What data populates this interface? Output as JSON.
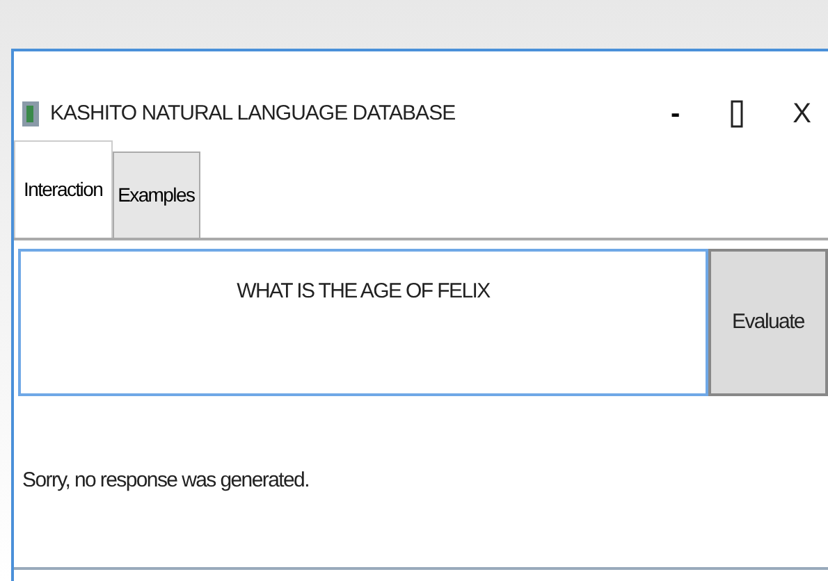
{
  "window": {
    "title": "KASHITO NATURAL LANGUAGE DATABASE",
    "controls": [
      "-",
      "X"
    ]
  },
  "tabs": [
    {
      "label": "Interaction",
      "selected": true
    },
    {
      "label": "Examples",
      "selected": false
    }
  ],
  "query": {
    "value": "WHAT IS THE AGE OF FELIX"
  },
  "evaluate_button": {
    "label": "Evaluate"
  },
  "response": "Sorry, no response was generated."
}
